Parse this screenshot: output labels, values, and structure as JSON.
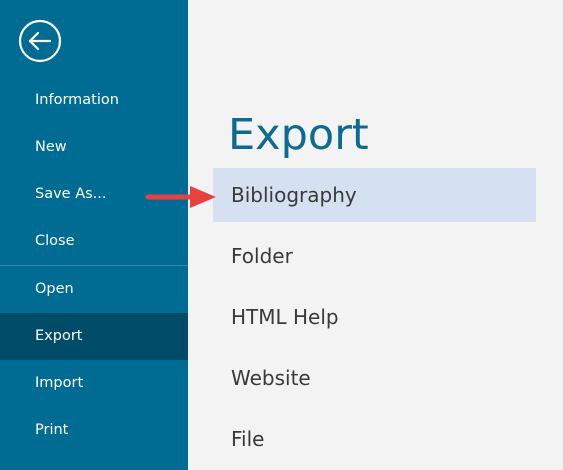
{
  "sidebar": {
    "back_icon": "back-arrow-circle-icon",
    "items": [
      {
        "label": "Information"
      },
      {
        "label": "New"
      },
      {
        "label": "Save As..."
      },
      {
        "label": "Close"
      },
      {
        "label": "Open"
      },
      {
        "label": "Export",
        "active": true
      },
      {
        "label": "Import"
      },
      {
        "label": "Print"
      }
    ]
  },
  "main": {
    "title": "Export",
    "options": [
      {
        "label": "Bibliography",
        "selected": true
      },
      {
        "label": "Folder"
      },
      {
        "label": "HTML Help"
      },
      {
        "label": "Website"
      },
      {
        "label": "File"
      }
    ]
  },
  "annotation": {
    "icon": "red-arrow-icon",
    "color": "#e8423f"
  },
  "colors": {
    "sidebar": "#006b93",
    "sidebar_active": "#004b68",
    "title": "#0d6a93",
    "selected_option": "#d5e1f1",
    "background": "#f3f3f3"
  }
}
